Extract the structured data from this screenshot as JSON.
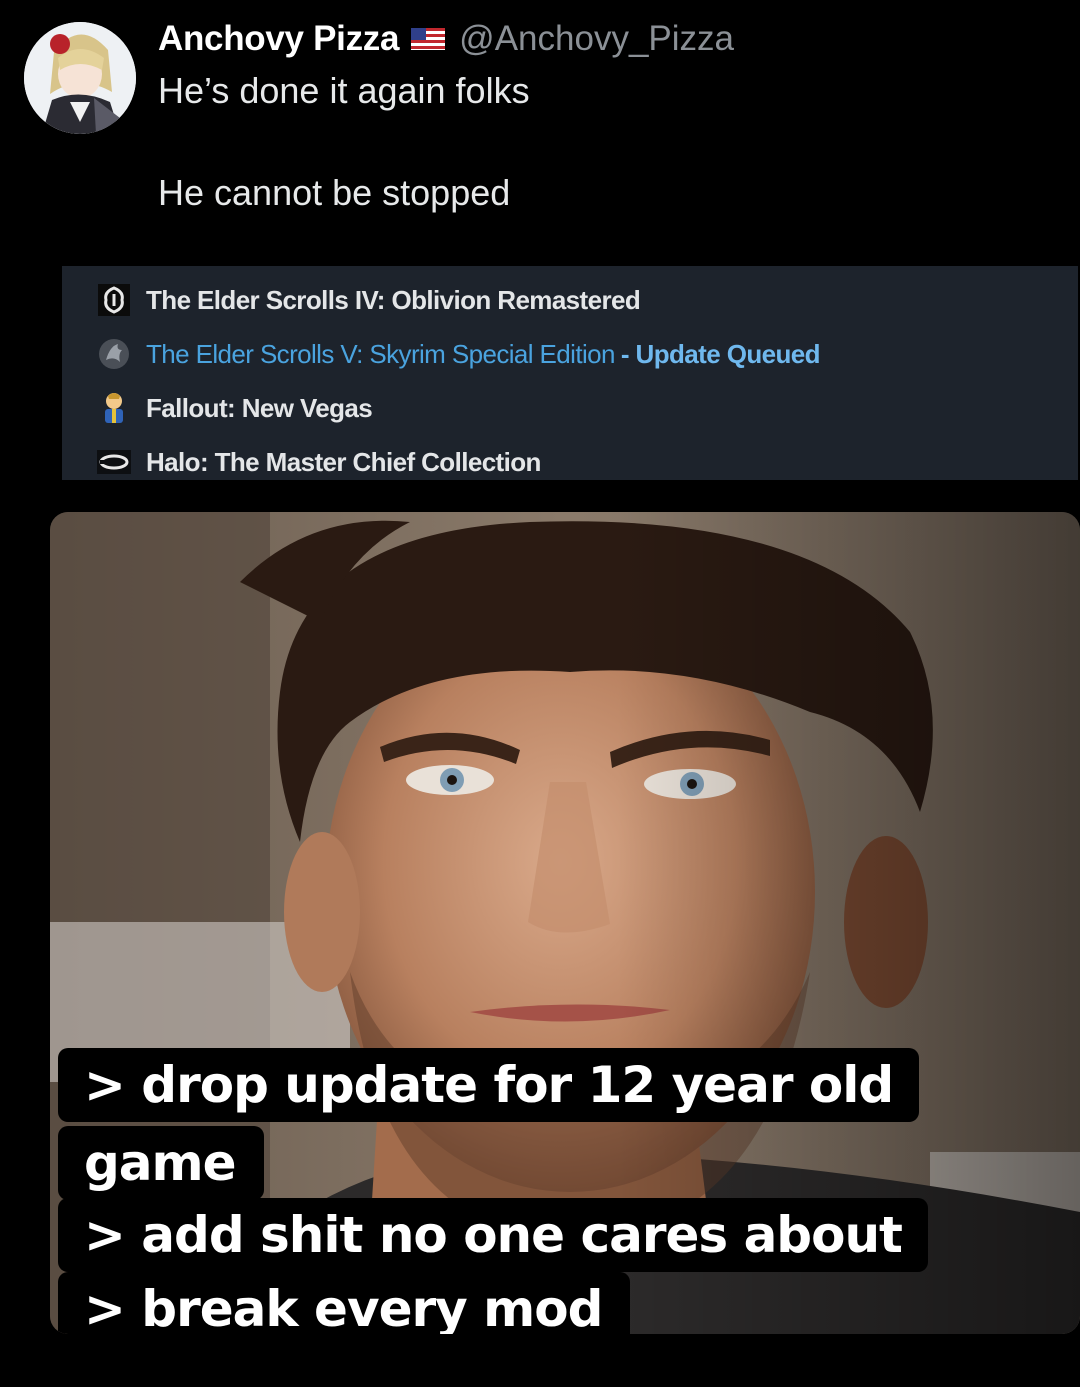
{
  "tweet": {
    "display_name": "Anchovy Pizza",
    "handle": "@Anchovy_Pizza",
    "flag_icon": "us-flag-icon",
    "text_line_1": "He’s done it again folks",
    "text_line_2": "He cannot be stopped"
  },
  "steam_library": {
    "games": [
      {
        "name": "The Elder Scrolls IV: Oblivion Remastered",
        "icon": "oblivion-icon",
        "status": ""
      },
      {
        "name": "The Elder Scrolls V: Skyrim Special Edition",
        "icon": "skyrim-icon",
        "status": "- Update Queued"
      },
      {
        "name": "Fallout: New Vegas",
        "icon": "vault-boy-icon",
        "status": ""
      },
      {
        "name": "Halo: The Master Chief Collection",
        "icon": "halo-icon",
        "status": ""
      }
    ],
    "colors": {
      "panel_bg": "#1d232c",
      "updating_text": "#4aa3df"
    }
  },
  "meme": {
    "caption_lines": [
      "> drop update for 12 year old",
      "game",
      "> add shit no one cares about",
      "> break every mod"
    ]
  }
}
